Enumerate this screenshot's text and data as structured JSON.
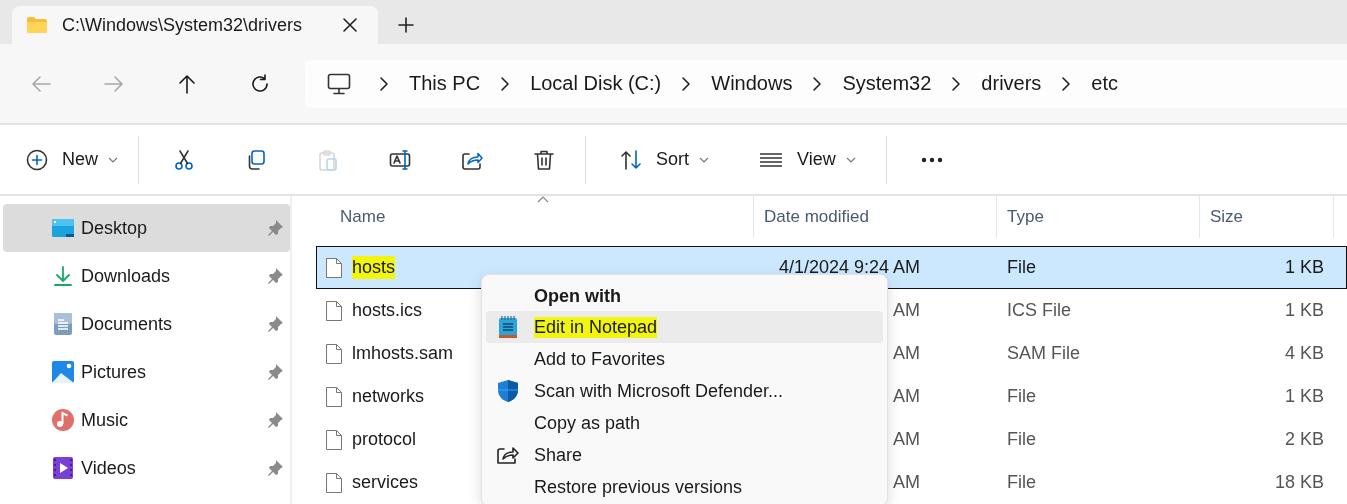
{
  "tab": {
    "title": "C:\\Windows\\System32\\drivers"
  },
  "nav_buttons": [
    {
      "kind": "back",
      "disabled": true
    },
    {
      "kind": "forward",
      "disabled": true
    },
    {
      "kind": "up",
      "disabled": false
    },
    {
      "kind": "refresh",
      "disabled": false
    }
  ],
  "address": {
    "crumbs": [
      "This PC",
      "Local Disk (C:)",
      "Windows",
      "System32",
      "drivers",
      "etc"
    ]
  },
  "toolbar": [
    {
      "kind": "new",
      "label": "New",
      "disabled": false
    },
    {
      "kind": "separator"
    },
    {
      "kind": "cut",
      "disabled": false
    },
    {
      "kind": "copy",
      "disabled": false
    },
    {
      "kind": "paste",
      "disabled": true
    },
    {
      "kind": "rename",
      "disabled": false
    },
    {
      "kind": "share",
      "disabled": false
    },
    {
      "kind": "delete",
      "disabled": false
    },
    {
      "kind": "separator"
    },
    {
      "kind": "sort",
      "label": "Sort",
      "disabled": false
    },
    {
      "kind": "view",
      "label": "View",
      "disabled": false
    },
    {
      "kind": "separator"
    },
    {
      "kind": "more",
      "disabled": false
    }
  ],
  "sidebar": {
    "items": [
      {
        "kind": "desktop",
        "label": "Desktop",
        "pinned": true,
        "selected": true
      },
      {
        "kind": "downloads",
        "label": "Downloads",
        "pinned": true,
        "selected": false
      },
      {
        "kind": "documents",
        "label": "Documents",
        "pinned": true,
        "selected": false
      },
      {
        "kind": "pictures",
        "label": "Pictures",
        "pinned": true,
        "selected": false
      },
      {
        "kind": "music",
        "label": "Music",
        "pinned": true,
        "selected": false
      },
      {
        "kind": "videos",
        "label": "Videos",
        "pinned": true,
        "selected": false
      }
    ]
  },
  "file_list": {
    "columns": [
      {
        "label": "Name",
        "sorted": true
      },
      {
        "label": "Date modified",
        "sorted": false
      },
      {
        "label": "Type",
        "sorted": false
      },
      {
        "label": "Size",
        "sorted": false
      }
    ],
    "rows": [
      {
        "name": "hosts",
        "date": "4/1/2024 9:24 AM",
        "type": "File",
        "size": "1 KB",
        "selected": true,
        "highlighted": true
      },
      {
        "name": "hosts.ics",
        "date": "AM",
        "type": "ICS File",
        "size": "1 KB",
        "selected": false,
        "highlighted": false
      },
      {
        "name": "lmhosts.sam",
        "date": "AM",
        "type": "SAM File",
        "size": "4 KB",
        "selected": false,
        "highlighted": false
      },
      {
        "name": "networks",
        "date": "AM",
        "type": "File",
        "size": "1 KB",
        "selected": false,
        "highlighted": false
      },
      {
        "name": "protocol",
        "date": "AM",
        "type": "File",
        "size": "2 KB",
        "selected": false,
        "highlighted": false
      },
      {
        "name": "services",
        "date": "AM",
        "type": "File",
        "size": "18 KB",
        "selected": false,
        "highlighted": false
      }
    ]
  },
  "context_menu": {
    "items": [
      {
        "kind": "heading",
        "label": "Open with"
      },
      {
        "kind": "notepad",
        "label": "Edit in Notepad",
        "hovered": true,
        "highlighted": true
      },
      {
        "kind": "plain",
        "label": "Add to Favorites",
        "hovered": false,
        "highlighted": false
      },
      {
        "kind": "defender",
        "label": "Scan with Microsoft Defender...",
        "hovered": false,
        "highlighted": false
      },
      {
        "kind": "plain",
        "label": "Copy as path",
        "hovered": false,
        "highlighted": false
      },
      {
        "kind": "share",
        "label": "Share",
        "hovered": false,
        "highlighted": false
      },
      {
        "kind": "plain",
        "label": "Restore previous versions",
        "hovered": false,
        "highlighted": false
      }
    ]
  }
}
